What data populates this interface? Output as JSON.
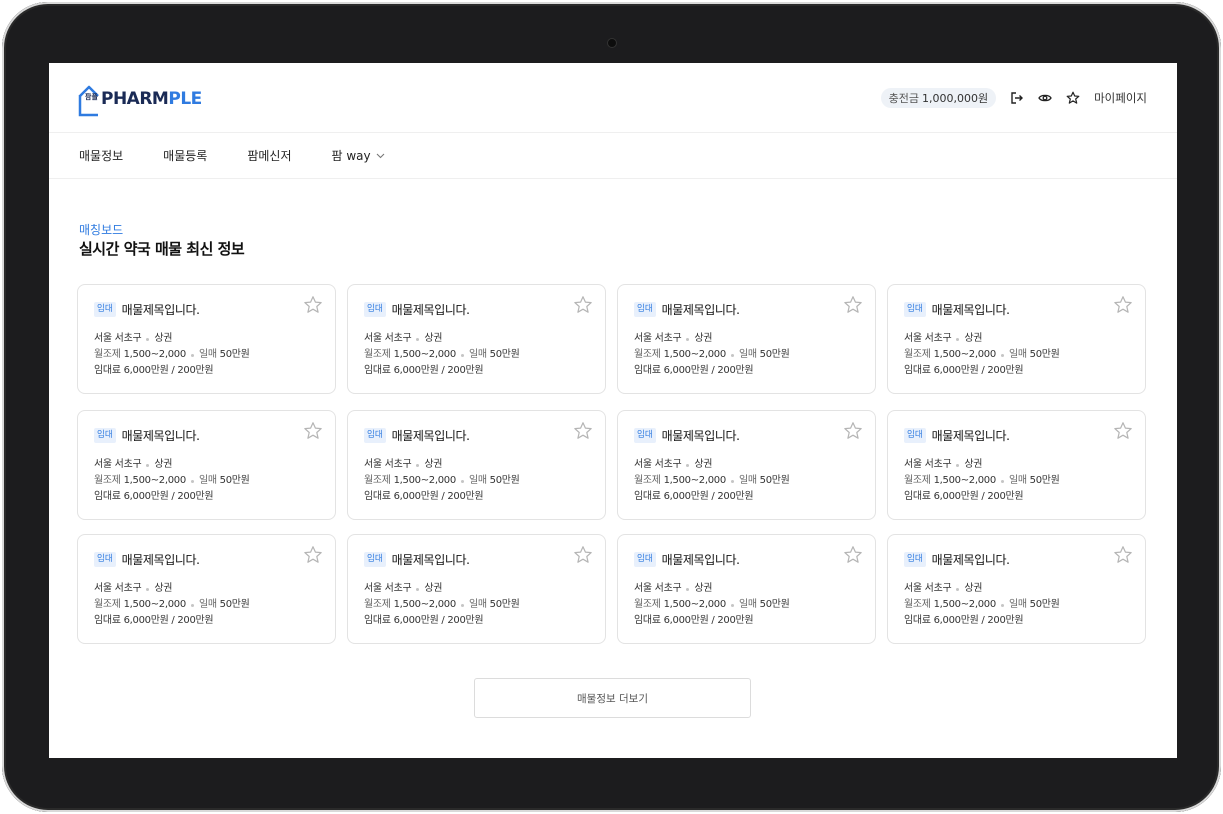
{
  "header": {
    "logo_sub": "팜플",
    "logo_dark": "PHARM",
    "logo_blue": "PLE",
    "charge_label": "충전금",
    "charge_value": "1,000,000원",
    "mypage_label": "마이페이지",
    "icons": [
      "logout-icon",
      "eye-icon",
      "star-icon"
    ]
  },
  "nav": {
    "items": [
      "매물정보",
      "매물등록",
      "팜메신저",
      "팜 way"
    ],
    "dropdown_icon": "chevron-down-icon"
  },
  "section": {
    "label": "매칭보드",
    "title": "실시간 약국 매물 최신 정보"
  },
  "cards": [
    {
      "tag": "임대",
      "title": "매물제목입니다.",
      "region": "서울 서초구",
      "type": "상권",
      "rent_label": "월조제",
      "rent_value": "1,500~2,000",
      "sale_label": "일매",
      "sale_value": "50만원",
      "fee": "임대료 6,000만원 / 200만원"
    },
    {
      "tag": "임대",
      "title": "매물제목입니다.",
      "region": "서울 서초구",
      "type": "상권",
      "rent_label": "월조제",
      "rent_value": "1,500~2,000",
      "sale_label": "일매",
      "sale_value": "50만원",
      "fee": "임대료 6,000만원 / 200만원"
    },
    {
      "tag": "임대",
      "title": "매물제목입니다.",
      "region": "서울 서초구",
      "type": "상권",
      "rent_label": "월조제",
      "rent_value": "1,500~2,000",
      "sale_label": "일매",
      "sale_value": "50만원",
      "fee": "임대료 6,000만원 / 200만원"
    },
    {
      "tag": "임대",
      "title": "매물제목입니다.",
      "region": "서울 서초구",
      "type": "상권",
      "rent_label": "월조제",
      "rent_value": "1,500~2,000",
      "sale_label": "일매",
      "sale_value": "50만원",
      "fee": "임대료 6,000만원 / 200만원"
    },
    {
      "tag": "임대",
      "title": "매물제목입니다.",
      "region": "서울 서초구",
      "type": "상권",
      "rent_label": "월조제",
      "rent_value": "1,500~2,000",
      "sale_label": "일매",
      "sale_value": "50만원",
      "fee": "임대료 6,000만원 / 200만원"
    },
    {
      "tag": "임대",
      "title": "매물제목입니다.",
      "region": "서울 서초구",
      "type": "상권",
      "rent_label": "월조제",
      "rent_value": "1,500~2,000",
      "sale_label": "일매",
      "sale_value": "50만원",
      "fee": "임대료 6,000만원 / 200만원"
    },
    {
      "tag": "임대",
      "title": "매물제목입니다.",
      "region": "서울 서초구",
      "type": "상권",
      "rent_label": "월조제",
      "rent_value": "1,500~2,000",
      "sale_label": "일매",
      "sale_value": "50만원",
      "fee": "임대료 6,000만원 / 200만원"
    },
    {
      "tag": "임대",
      "title": "매물제목입니다.",
      "region": "서울 서초구",
      "type": "상권",
      "rent_label": "월조제",
      "rent_value": "1,500~2,000",
      "sale_label": "일매",
      "sale_value": "50만원",
      "fee": "임대료 6,000만원 / 200만원"
    },
    {
      "tag": "임대",
      "title": "매물제목입니다.",
      "region": "서울 서초구",
      "type": "상권",
      "rent_label": "월조제",
      "rent_value": "1,500~2,000",
      "sale_label": "일매",
      "sale_value": "50만원",
      "fee": "임대료 6,000만원 / 200만원"
    },
    {
      "tag": "임대",
      "title": "매물제목입니다.",
      "region": "서울 서초구",
      "type": "상권",
      "rent_label": "월조제",
      "rent_value": "1,500~2,000",
      "sale_label": "일매",
      "sale_value": "50만원",
      "fee": "임대료 6,000만원 / 200만원"
    },
    {
      "tag": "임대",
      "title": "매물제목입니다.",
      "region": "서울 서초구",
      "type": "상권",
      "rent_label": "월조제",
      "rent_value": "1,500~2,000",
      "sale_label": "일매",
      "sale_value": "50만원",
      "fee": "임대료 6,000만원 / 200만원"
    },
    {
      "tag": "임대",
      "title": "매물제목입니다.",
      "region": "서울 서초구",
      "type": "상권",
      "rent_label": "월조제",
      "rent_value": "1,500~2,000",
      "sale_label": "일매",
      "sale_value": "50만원",
      "fee": "임대료 6,000만원 / 200만원"
    }
  ],
  "more_button": "매물정보 더보기",
  "colors": {
    "accent": "#2f7be0",
    "logo_dark": "#1a2a55",
    "bezel": "#1c1c1e"
  }
}
